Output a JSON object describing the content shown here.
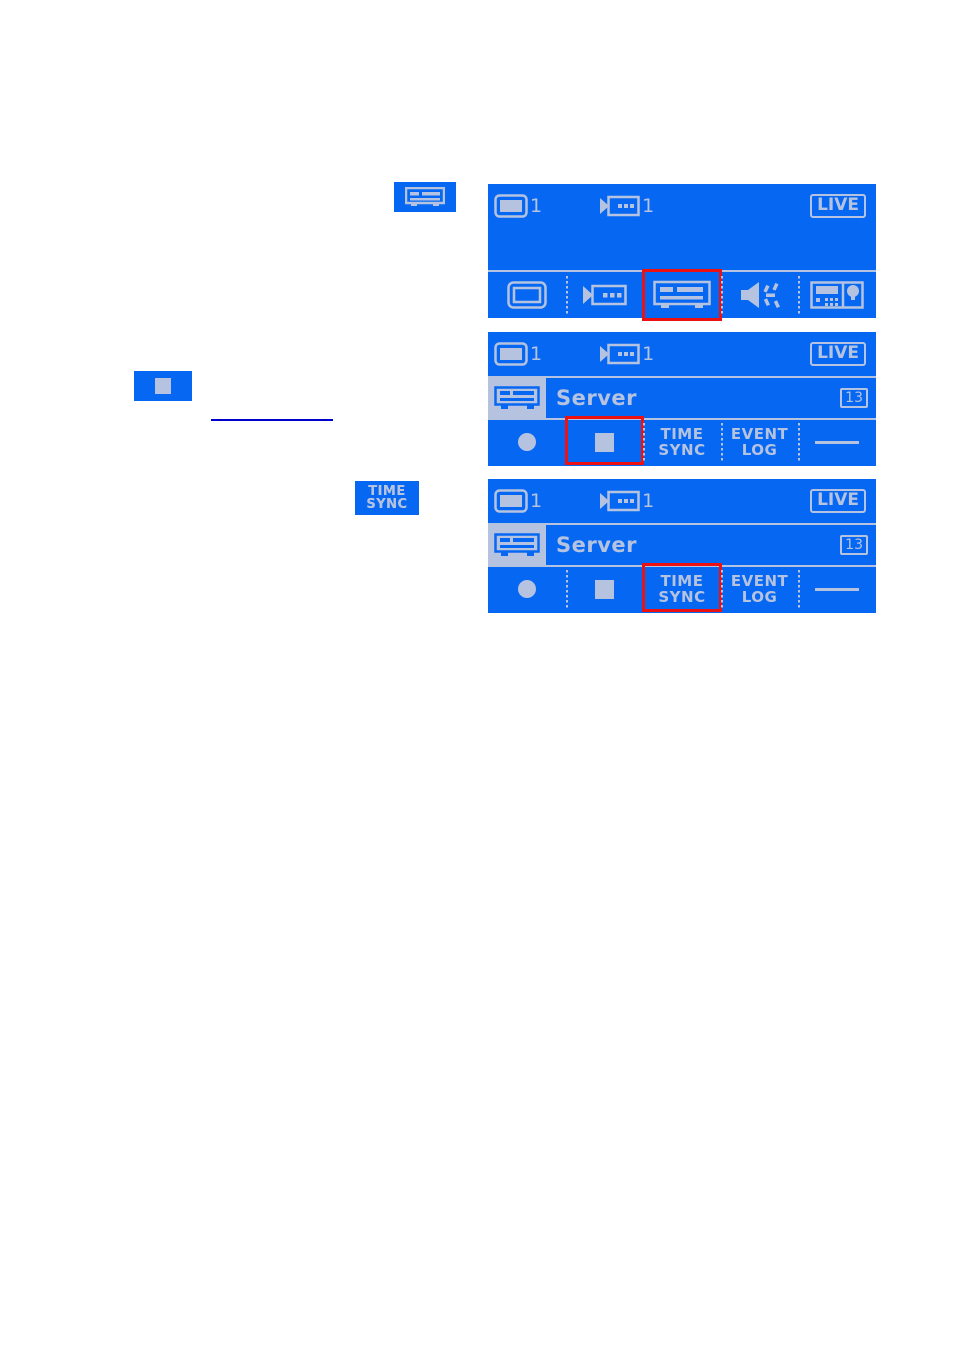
{
  "colors": {
    "lcd_background": "#0668f2",
    "lcd_foreground": "#b6c3e0",
    "selection_outline": "#ee1111",
    "rule": "#0000cc",
    "page_background": "#ffffff"
  },
  "inline_badges": {
    "server_chip": {
      "icon": "server-icon"
    },
    "stop_chip": {
      "icon": "stop-square-icon"
    },
    "time_sync_chip": {
      "line1": "TIME",
      "line2": "SYNC"
    }
  },
  "panels": [
    {
      "id": "panel-1",
      "statusbar": {
        "monitor_icon": "monitor-icon",
        "monitor_count": "1",
        "camera_icon": "camera-icon",
        "camera_count": "1",
        "mode_badge": "LIVE"
      },
      "toolbar": {
        "items": [
          {
            "icon": "monitor-icon",
            "label": "Monitor",
            "selected": false
          },
          {
            "icon": "camera-icon",
            "label": "Camera",
            "selected": false
          },
          {
            "icon": "server-icon",
            "label": "Server",
            "selected": true
          },
          {
            "icon": "speaker-icon",
            "label": "Audio",
            "selected": false
          },
          {
            "icon": "controller-icon",
            "label": "Controller",
            "selected": false
          }
        ]
      }
    },
    {
      "id": "panel-2",
      "statusbar": {
        "monitor_icon": "monitor-icon",
        "monitor_count": "1",
        "camera_icon": "camera-icon",
        "camera_count": "1",
        "mode_badge": "LIVE"
      },
      "server_row": {
        "icon": "server-icon",
        "name": "Server",
        "number": "13"
      },
      "action_row": {
        "items": [
          {
            "type": "icon",
            "icon": "record-dot-icon",
            "label": "Record",
            "selected": false
          },
          {
            "type": "icon",
            "icon": "stop-square-icon",
            "label": "Stop",
            "selected": true
          },
          {
            "type": "text",
            "line1": "TIME",
            "line2": "SYNC",
            "selected": false
          },
          {
            "type": "text",
            "line1": "EVENT",
            "line2": "LOG",
            "selected": false
          },
          {
            "type": "dash",
            "icon": "dash-icon",
            "label": "Empty",
            "selected": false
          }
        ]
      }
    },
    {
      "id": "panel-3",
      "statusbar": {
        "monitor_icon": "monitor-icon",
        "monitor_count": "1",
        "camera_icon": "camera-icon",
        "camera_count": "1",
        "mode_badge": "LIVE"
      },
      "server_row": {
        "icon": "server-icon",
        "name": "Server",
        "number": "13"
      },
      "action_row": {
        "items": [
          {
            "type": "icon",
            "icon": "record-dot-icon",
            "label": "Record",
            "selected": false
          },
          {
            "type": "icon",
            "icon": "stop-square-icon",
            "label": "Stop",
            "selected": false
          },
          {
            "type": "text",
            "line1": "TIME",
            "line2": "SYNC",
            "selected": true
          },
          {
            "type": "text",
            "line1": "EVENT",
            "line2": "LOG",
            "selected": false
          },
          {
            "type": "dash",
            "icon": "dash-icon",
            "label": "Empty",
            "selected": false
          }
        ]
      }
    }
  ]
}
